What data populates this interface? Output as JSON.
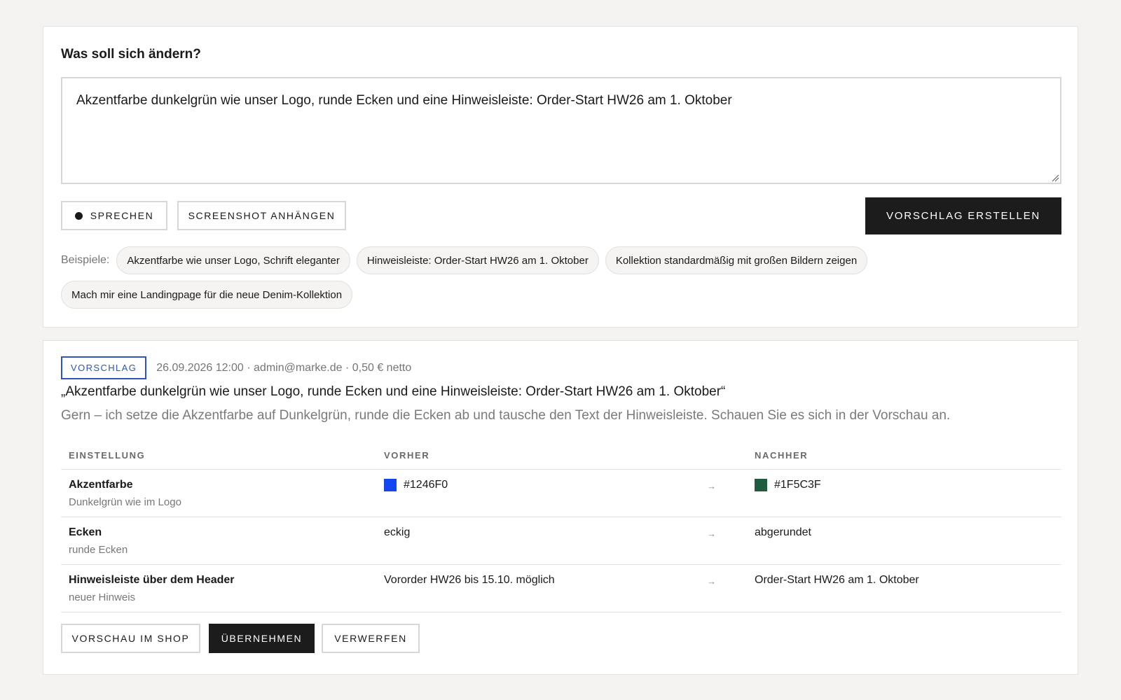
{
  "composer": {
    "question": "Was soll sich ändern?",
    "input_value": "Akzentfarbe dunkelgrün wie unser Logo, runde Ecken und eine Hinweisleiste: Order-Start HW26 am 1. Oktober",
    "speak_label": "SPRECHEN",
    "screenshot_label": "SCREENSHOT ANHÄNGEN",
    "create_label": "VORSCHLAG ERSTELLEN",
    "examples_label": "Beispiele:",
    "examples": [
      "Akzentfarbe wie unser Logo, Schrift eleganter",
      "Hinweisleiste: Order-Start HW26 am 1. Oktober",
      "Kollektion standardmäßig mit großen Bildern zeigen",
      "Mach mir eine Landingpage für die neue Denim-Kollektion"
    ]
  },
  "proposal": {
    "badge": "VORSCHLAG",
    "meta": "26.09.2026 12:00 · admin@marke.de · 0,50 € netto",
    "quote": "„Akzentfarbe dunkelgrün wie unser Logo, runde Ecken und eine Hinweisleiste: Order-Start HW26 am 1. Oktober“",
    "reply": "Gern – ich setze die Akzentfarbe auf Dunkelgrün, runde die Ecken ab und tausche den Text der Hinweisleiste. Schauen Sie es sich in der Vorschau an.",
    "table": {
      "headers": [
        "EINSTELLUNG",
        "VORHER",
        "NACHHER"
      ],
      "arrow": "→",
      "rows": [
        {
          "name": "Akzentfarbe",
          "sub": "Dunkelgrün wie im Logo",
          "before": "#1246F0",
          "after": "#1F5C3F",
          "before_color": "#1246F0",
          "after_color": "#1F5C3F"
        },
        {
          "name": "Ecken",
          "sub": "runde Ecken",
          "before": "eckig",
          "after": "abgerundet"
        },
        {
          "name": "Hinweisleiste über dem Header",
          "sub": "neuer Hinweis",
          "before": "Vororder HW26 bis 15.10. möglich",
          "after": "Order-Start HW26 am 1. Oktober"
        }
      ]
    },
    "preview_label": "VORSCHAU IM SHOP",
    "apply_label": "ÜBERNEHMEN",
    "discard_label": "VERWERFEN"
  }
}
